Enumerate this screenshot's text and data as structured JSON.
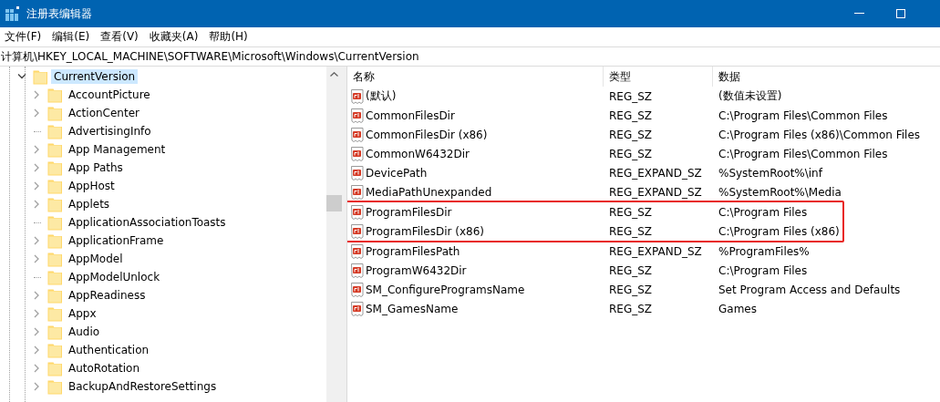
{
  "window": {
    "title": "注册表编辑器"
  },
  "menu": [
    "文件(F)",
    "编辑(E)",
    "查看(V)",
    "收藏夹(A)",
    "帮助(H)"
  ],
  "address": "计算机\\HKEY_LOCAL_MACHINE\\SOFTWARE\\Microsoft\\Windows\\CurrentVersion",
  "tree": {
    "label": "CurrentVersion",
    "expanded": true,
    "selected": true,
    "children": [
      {
        "label": "AccountPicture",
        "kind": "expandable"
      },
      {
        "label": "ActionCenter",
        "kind": "expandable"
      },
      {
        "label": "AdvertisingInfo",
        "kind": "leaf"
      },
      {
        "label": "App Management",
        "kind": "expandable"
      },
      {
        "label": "App Paths",
        "kind": "expandable"
      },
      {
        "label": "AppHost",
        "kind": "expandable"
      },
      {
        "label": "Applets",
        "kind": "expandable"
      },
      {
        "label": "ApplicationAssociationToasts",
        "kind": "leaf"
      },
      {
        "label": "ApplicationFrame",
        "kind": "expandable"
      },
      {
        "label": "AppModel",
        "kind": "expandable"
      },
      {
        "label": "AppModelUnlock",
        "kind": "leaf"
      },
      {
        "label": "AppReadiness",
        "kind": "expandable"
      },
      {
        "label": "Appx",
        "kind": "expandable"
      },
      {
        "label": "Audio",
        "kind": "expandable"
      },
      {
        "label": "Authentication",
        "kind": "expandable"
      },
      {
        "label": "AutoRotation",
        "kind": "expandable"
      },
      {
        "label": "BackupAndRestoreSettings",
        "kind": "expandable"
      }
    ]
  },
  "table": {
    "columns": [
      "名称",
      "类型",
      "数据"
    ],
    "rows": [
      {
        "name": "(默认)",
        "type": "REG_SZ",
        "data": "(数值未设置)",
        "marked": false
      },
      {
        "name": "CommonFilesDir",
        "type": "REG_SZ",
        "data": "C:\\Program Files\\Common Files",
        "marked": false
      },
      {
        "name": "CommonFilesDir (x86)",
        "type": "REG_SZ",
        "data": "C:\\Program Files (x86)\\Common Files",
        "marked": false
      },
      {
        "name": "CommonW6432Dir",
        "type": "REG_SZ",
        "data": "C:\\Program Files\\Common Files",
        "marked": false
      },
      {
        "name": "DevicePath",
        "type": "REG_EXPAND_SZ",
        "data": "%SystemRoot%\\inf",
        "marked": false
      },
      {
        "name": "MediaPathUnexpanded",
        "type": "REG_EXPAND_SZ",
        "data": "%SystemRoot%\\Media",
        "marked": false
      },
      {
        "name": "ProgramFilesDir",
        "type": "REG_SZ",
        "data": "C:\\Program Files",
        "marked": true
      },
      {
        "name": "ProgramFilesDir (x86)",
        "type": "REG_SZ",
        "data": "C:\\Program Files (x86)",
        "marked": true
      },
      {
        "name": "ProgramFilesPath",
        "type": "REG_EXPAND_SZ",
        "data": "%ProgramFiles%",
        "marked": false
      },
      {
        "name": "ProgramW6432Dir",
        "type": "REG_SZ",
        "data": "C:\\Program Files",
        "marked": false
      },
      {
        "name": "SM_ConfigureProgramsName",
        "type": "REG_SZ",
        "data": "Set Program Access and Defaults",
        "marked": false
      },
      {
        "name": "SM_GamesName",
        "type": "REG_SZ",
        "data": "Games",
        "marked": false
      }
    ]
  }
}
